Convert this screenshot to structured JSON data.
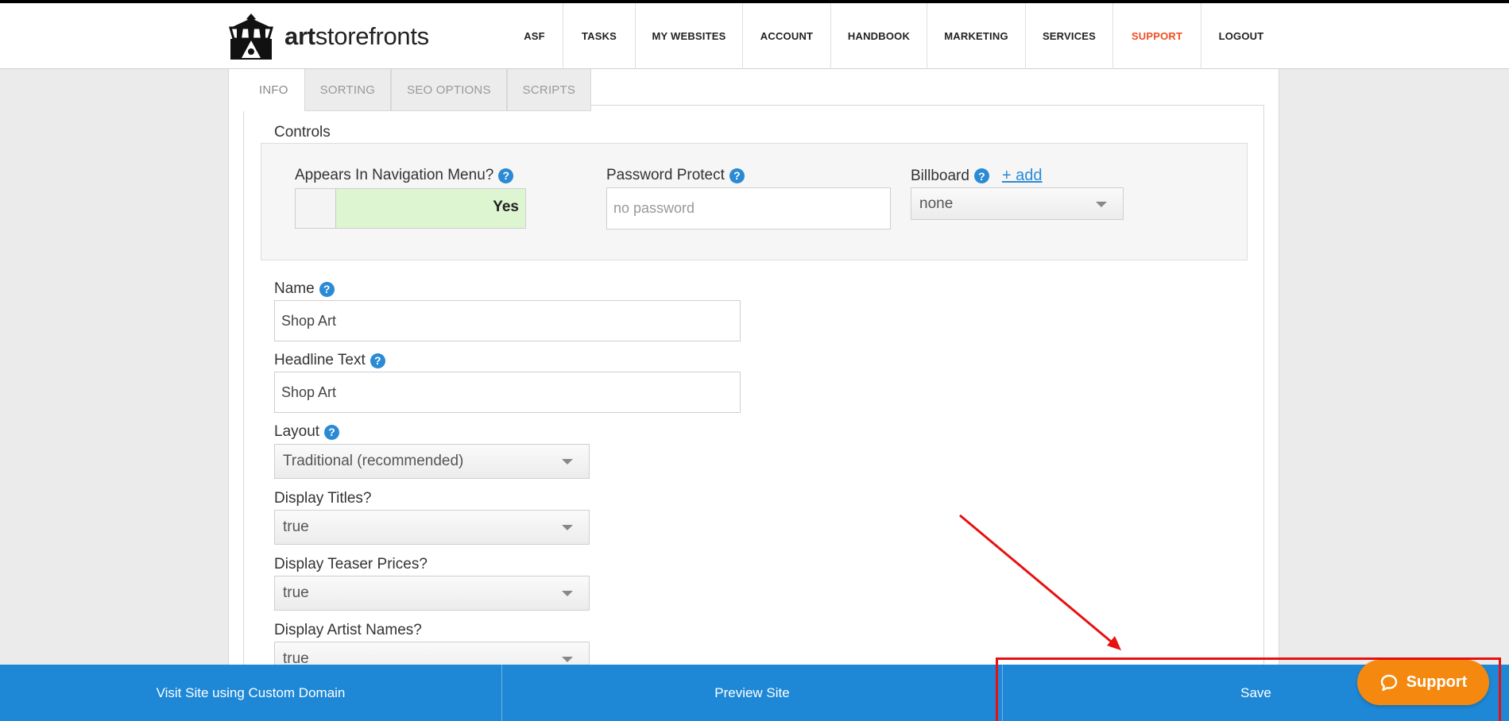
{
  "header": {
    "logo": {
      "bold": "art",
      "rest": "storefronts"
    },
    "nav": [
      "ASF",
      "TASKS",
      "MY WEBSITES",
      "ACCOUNT",
      "HANDBOOK",
      "MARKETING",
      "SERVICES",
      "SUPPORT",
      "LOGOUT"
    ],
    "active_nav": "SUPPORT",
    "active_color": "#f04e23"
  },
  "tabs": [
    "INFO",
    "SORTING",
    "SEO OPTIONS",
    "SCRIPTS"
  ],
  "active_tab": "INFO",
  "controls": {
    "title": "Controls",
    "nav_menu": {
      "label": "Appears In Navigation Menu?",
      "value": "Yes"
    },
    "password": {
      "label": "Password Protect",
      "placeholder": "no password",
      "value": ""
    },
    "billboard": {
      "label": "Billboard",
      "add_link": "+ add",
      "selected": "none"
    }
  },
  "form": {
    "name": {
      "label": "Name",
      "value": "Shop Art"
    },
    "headline": {
      "label": "Headline Text",
      "value": "Shop Art"
    },
    "layout": {
      "label": "Layout",
      "selected": "Traditional (recommended)"
    },
    "display_titles": {
      "label": "Display Titles?",
      "selected": "true"
    },
    "display_teaser_prices": {
      "label": "Display Teaser Prices?",
      "selected": "true"
    },
    "display_artist_names": {
      "label": "Display Artist Names?",
      "selected": "true"
    }
  },
  "bottom_bar": {
    "visit": "Visit Site using Custom Domain",
    "preview": "Preview Site",
    "save": "Save"
  },
  "support_button": {
    "label": "Support",
    "icon": "chat-bubble-icon"
  },
  "help_icon": "?",
  "colors": {
    "accent_blue": "#1e88d6",
    "support_orange": "#f5890f",
    "annotation_red": "#e81010",
    "toggle_on": "#def5d1"
  }
}
